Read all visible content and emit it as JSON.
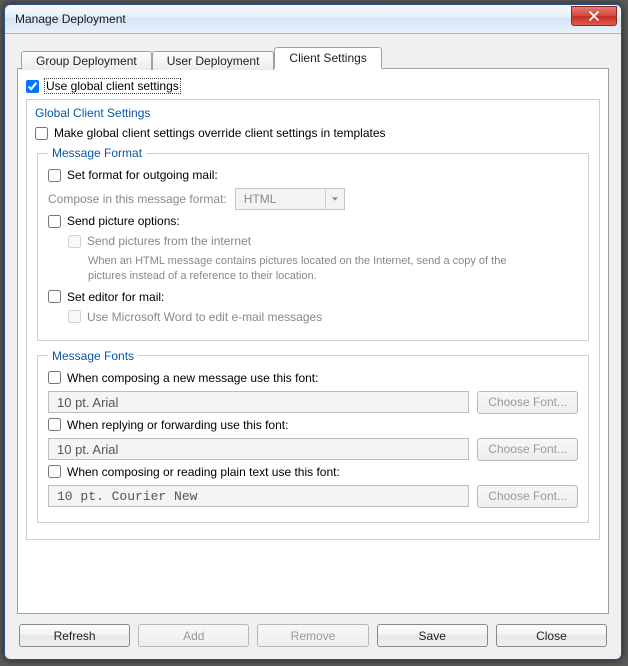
{
  "window": {
    "title": "Manage Deployment"
  },
  "tabs": [
    {
      "label": "Group Deployment"
    },
    {
      "label": "User Deployment"
    },
    {
      "label": "Client Settings"
    }
  ],
  "useGlobal": {
    "label": "Use global client settings",
    "checked": true
  },
  "globalSection": {
    "title": "Global Client Settings",
    "override": {
      "label": "Make global client settings override client settings in templates",
      "checked": false
    }
  },
  "msgFormat": {
    "legend": "Message Format",
    "setFormat": {
      "label": "Set format for outgoing mail:",
      "checked": false
    },
    "composeLabel": "Compose in this message format:",
    "composeValue": "HTML",
    "sendPicture": {
      "label": "Send picture options:",
      "checked": false
    },
    "sendFromInternet": {
      "label": "Send pictures from the internet",
      "checked": false
    },
    "sendHint": "When an HTML message contains pictures located on the Internet, send a copy of the pictures instead of a reference to their location.",
    "setEditor": {
      "label": "Set editor for mail:",
      "checked": false
    },
    "useWord": {
      "label": "Use Microsoft Word to edit e-mail messages",
      "checked": false
    }
  },
  "msgFonts": {
    "legend": "Message Fonts",
    "compose": {
      "label": "When composing a new message use this font:",
      "checked": false,
      "value": "10 pt. Arial"
    },
    "reply": {
      "label": "When replying or forwarding use this font:",
      "checked": false,
      "value": "10 pt. Arial"
    },
    "plain": {
      "label": "When composing or reading plain text use this font:",
      "checked": false,
      "value": "10 pt. Courier New"
    },
    "chooseBtn": "Choose Font..."
  },
  "footer": {
    "refresh": "Refresh",
    "add": "Add",
    "remove": "Remove",
    "save": "Save",
    "close": "Close"
  }
}
